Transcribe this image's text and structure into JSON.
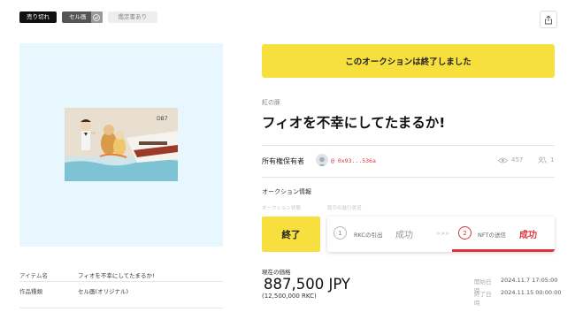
{
  "tags": {
    "sold_out": "売り切れ",
    "cel": "セル画",
    "appraisal": "鑑定書あり"
  },
  "item_info": {
    "name_key": "アイテム名",
    "name_value": "フィオを不幸にしてたまるか!",
    "type_key": "作品種類",
    "type_value": "セル画(オリジナル)"
  },
  "banner": {
    "text": "このオークションは終了しました"
  },
  "series": "紅の豚",
  "title": "フィオを不幸にしてたまるか!",
  "owner": {
    "label": "所有権保有者",
    "address": "@ 0x93...536a"
  },
  "stats": {
    "views": "457",
    "likes": "1"
  },
  "auction": {
    "title": "オークション情報",
    "status_caption": "オークション状態",
    "process_caption": "取引の進行状況",
    "status_button": "終了",
    "steps": [
      {
        "number": "1",
        "label": "RKCの引出",
        "status": "成功"
      },
      {
        "number": "2",
        "label": "NFTの送信",
        "status": "成功"
      }
    ],
    "arrow": ">>>"
  },
  "price": {
    "label": "現在の価格",
    "value": "887,500 JPY",
    "sub": "(12,500,000 RKC)"
  },
  "dates": {
    "start_key": "開始日時",
    "start_value": "2024.11.7 17:05:00",
    "end_key": "終了日時",
    "end_value": "2024.11.15 00:00:00"
  },
  "colors": {
    "accent_yellow": "#f7df3d",
    "success_red": "#d9363e",
    "art_bg": "#e8f6fd"
  },
  "icons": {
    "share": "share-icon",
    "views": "eye-icon",
    "likes": "people-icon",
    "cel_check": "check-icon"
  }
}
